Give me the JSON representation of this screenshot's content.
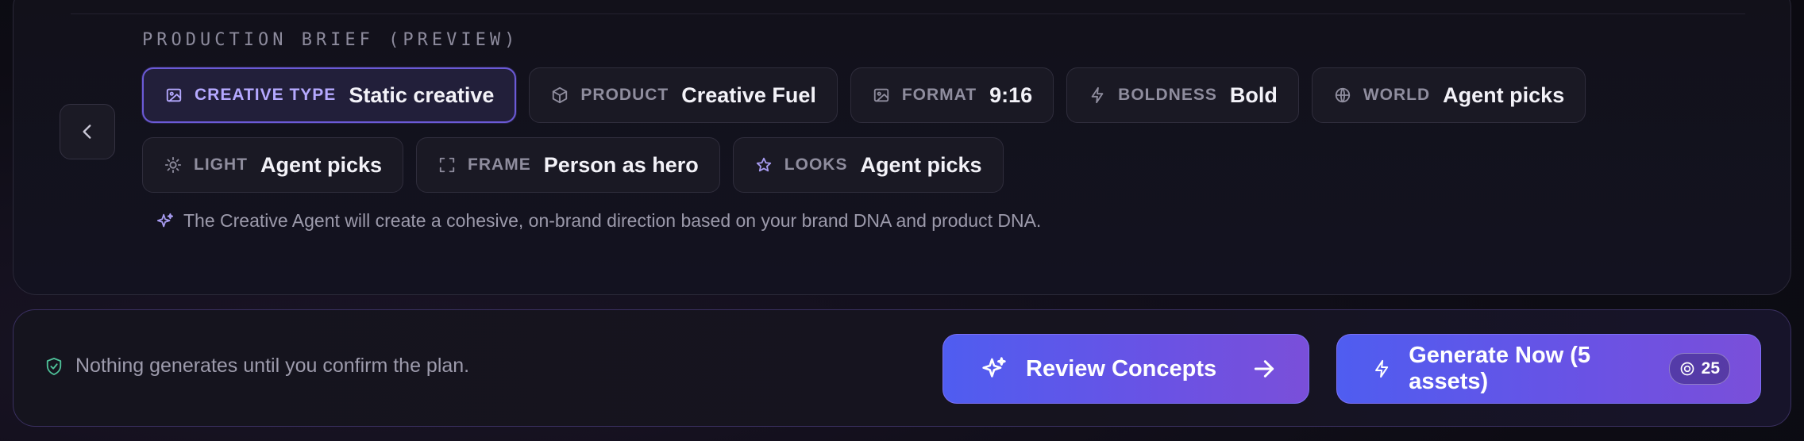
{
  "brief": {
    "title": "PRODUCTION BRIEF (PREVIEW)",
    "chips_row1": [
      {
        "icon": "image-icon",
        "label": "CREATIVE TYPE",
        "value": "Static creative",
        "active": true
      },
      {
        "icon": "box-icon",
        "label": "PRODUCT",
        "value": "Creative Fuel",
        "active": false
      },
      {
        "icon": "image-icon",
        "label": "FORMAT",
        "value": "9:16",
        "active": false
      },
      {
        "icon": "lightning-icon",
        "label": "BOLDNESS",
        "value": "Bold",
        "active": false
      },
      {
        "icon": "globe-icon",
        "label": "WORLD",
        "value": "Agent picks",
        "active": false
      }
    ],
    "chips_row2": [
      {
        "icon": "sun-icon",
        "label": "LIGHT",
        "value": "Agent picks",
        "active": false
      },
      {
        "icon": "frame-icon",
        "label": "FRAME",
        "value": "Person as hero",
        "active": false
      },
      {
        "icon": "star-icon",
        "label": "LOOKS",
        "value": "Agent picks",
        "active": false
      }
    ],
    "note": "The Creative Agent will create a cohesive, on-brand direction based on your brand DNA and product DNA."
  },
  "footer": {
    "note": "Nothing generates until you confirm the plan.",
    "review_label": "Review Concepts",
    "generate_label": "Generate Now (5 assets)",
    "credits": "25"
  },
  "colors": {
    "accent": "#6b5ad6",
    "button_gradient_start": "#4f5df0",
    "button_gradient_end": "#7a4fd9",
    "shield_green": "#4fc39a"
  }
}
